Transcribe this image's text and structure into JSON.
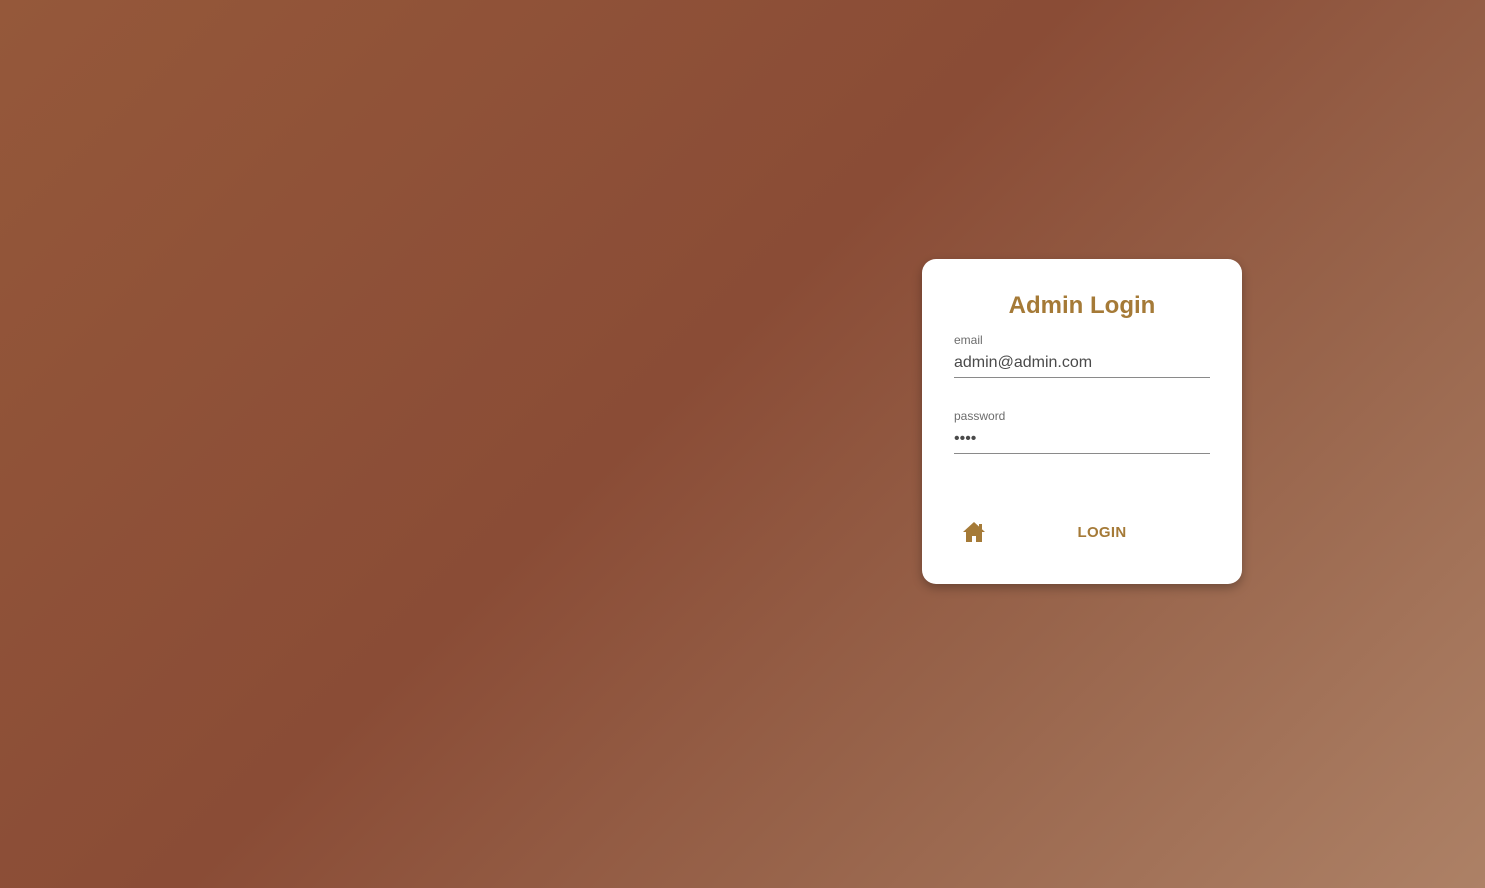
{
  "login_card": {
    "title": "Admin Login",
    "email": {
      "label": "email",
      "value": "admin@admin.com"
    },
    "password": {
      "label": "password",
      "value": "••••"
    },
    "home_icon": "home-icon",
    "login_label": "LOGIN"
  },
  "colors": {
    "accent": "#a57a37",
    "background_start": "#95583a",
    "background_mid": "#8a4c36",
    "background_end": "#ad8166",
    "card": "#ffffff"
  }
}
